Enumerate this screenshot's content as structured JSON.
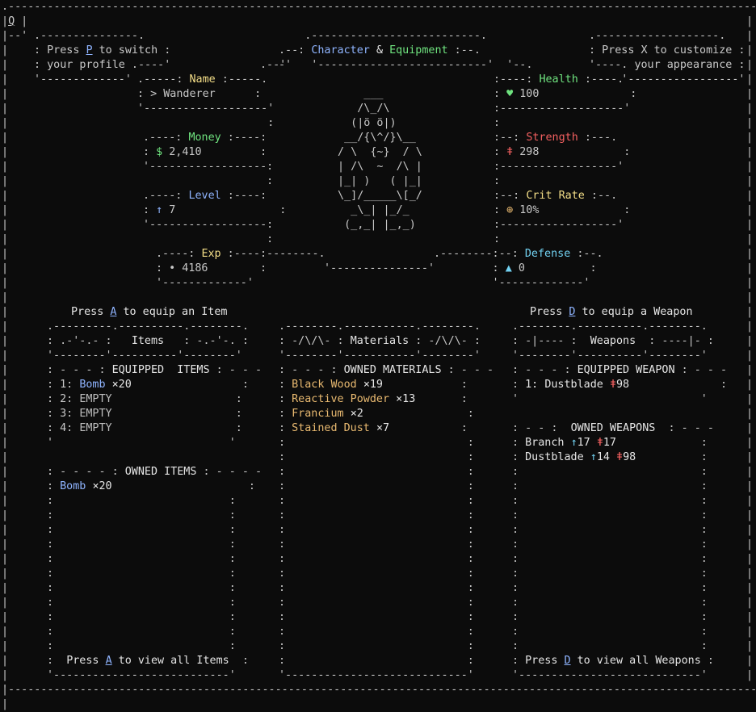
{
  "corner_key": "Q",
  "profile_hint": {
    "line1_prefix": "Press ",
    "key": "P",
    "line1_suffix": " to switch",
    "line2": "your profile"
  },
  "title": {
    "part1": "Character",
    "amp": "&",
    "part2": "Equipment"
  },
  "appearance_hint": {
    "line1": "Press X to customize",
    "line2": "your appearance"
  },
  "stats_left": {
    "name": {
      "label": "Name",
      "icon": ">",
      "value": "Wanderer"
    },
    "money": {
      "label": "Money",
      "icon": "$",
      "value": "2,410"
    },
    "level": {
      "label": "Level",
      "icon": "↑",
      "value": "7"
    },
    "exp": {
      "label": "Exp",
      "icon": "•",
      "value": "4186"
    }
  },
  "stats_right": {
    "health": {
      "label": "Health",
      "icon": "♥",
      "value": "100"
    },
    "strength": {
      "label": "Strength",
      "icon": "ǂ",
      "value": "298"
    },
    "crit": {
      "label": "Crit Rate",
      "icon": "⊕",
      "value": "10%"
    },
    "defense": {
      "label": "Defense",
      "icon": "▲",
      "value": "0"
    }
  },
  "avatar_art": [
    "     ___",
    "    /\\_/\\",
    "   (|ö ö|)",
    "  __/{\\^/}\\__",
    " / \\  {~}  / \\",
    " | /\\  ~  /\\ |",
    " |_| )   ( |_|",
    " \\_]/_____\\[_/",
    "   _\\_| |_/_",
    "  (_,_| |_,_)"
  ],
  "items_panel": {
    "hint_prefix": "Press ",
    "hint_key": "A",
    "hint_suffix": " to equip an Item",
    "title": "Items",
    "equipped_header": "EQUIPPED  ITEMS",
    "slots": [
      {
        "num": "1:",
        "name": "Bomb",
        "qty": "×20",
        "empty": false
      },
      {
        "num": "2:",
        "name": "EMPTY",
        "qty": "",
        "empty": true
      },
      {
        "num": "3:",
        "name": "EMPTY",
        "qty": "",
        "empty": true
      },
      {
        "num": "4:",
        "name": "EMPTY",
        "qty": "",
        "empty": true
      }
    ],
    "owned_header": "OWNED ITEMS",
    "owned": [
      {
        "name": "Bomb",
        "qty": "×20"
      }
    ],
    "footer_prefix": "Press ",
    "footer_key": "A",
    "footer_suffix": " to view all Items"
  },
  "materials_panel": {
    "title": "Materials",
    "owned_header": "OWNED MATERIALS",
    "owned": [
      {
        "name": "Black Wood",
        "qty": "×19"
      },
      {
        "name": "Reactive Powder",
        "qty": "×13"
      },
      {
        "name": "Francium",
        "qty": "×2"
      },
      {
        "name": "Stained Dust",
        "qty": "×7"
      }
    ]
  },
  "weapons_panel": {
    "hint_prefix": "Press ",
    "hint_key": "D",
    "hint_suffix": " to equip a Weapon",
    "title": "Weapons",
    "equipped_header": "EQUIPPED WEAPON",
    "equipped": {
      "num": "1:",
      "name": "Dustblade",
      "str_icon": "ǂ",
      "str": "98"
    },
    "owned_header": "OWNED WEAPONS",
    "owned": [
      {
        "name": "Branch",
        "lvl_icon": "↑",
        "lvl": "17",
        "str_icon": "ǂ",
        "str": "17"
      },
      {
        "name": "Dustblade",
        "lvl_icon": "↑",
        "lvl": "14",
        "str_icon": "ǂ",
        "str": "98"
      }
    ],
    "footer_prefix": "Press ",
    "footer_key": "D",
    "footer_suffix": " to view all Weapons"
  },
  "colors": {
    "background": "#0c0c0c",
    "border": "#c8c8c8",
    "accent_blue": "#8fb4ff",
    "accent_green": "#6fe37f",
    "accent_yellow": "#f5df88",
    "accent_red": "#f46060",
    "accent_orange": "#e8b970"
  }
}
